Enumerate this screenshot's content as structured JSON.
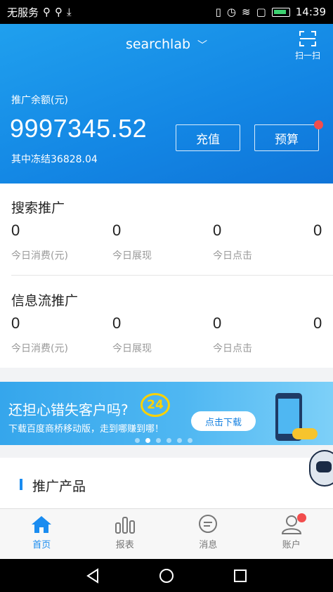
{
  "status_bar": {
    "carrier": "无服务",
    "time": "14:39"
  },
  "header": {
    "account": "searchlab",
    "scan_label": "扫一扫",
    "balance_label": "推广余额(元)",
    "balance_value": "9997345.52",
    "frozen_text": "其中冻结36828.04",
    "recharge_label": "充值",
    "budget_label": "预算"
  },
  "search_promo": {
    "title": "搜索推广",
    "stats": [
      {
        "value": "0",
        "label": "今日消费(元)"
      },
      {
        "value": "0",
        "label": "今日展现"
      },
      {
        "value": "0",
        "label": "今日点击"
      },
      {
        "value": "0",
        "label": ""
      }
    ]
  },
  "feed_promo": {
    "title": "信息流推广",
    "stats": [
      {
        "value": "0",
        "label": "今日消费(元)"
      },
      {
        "value": "0",
        "label": "今日展现"
      },
      {
        "value": "0",
        "label": "今日点击"
      },
      {
        "value": "0",
        "label": ""
      }
    ]
  },
  "banner": {
    "headline": "还担心错失客户吗?",
    "badge": "24",
    "subline": "下载百度商桥移动版，走到哪赚到哪！",
    "cta": "点击下载"
  },
  "products": {
    "title": "推广产品"
  },
  "tabs": [
    {
      "label": "首页",
      "icon": "home-icon",
      "active": true
    },
    {
      "label": "报表",
      "icon": "chart-icon",
      "active": false
    },
    {
      "label": "消息",
      "icon": "message-icon",
      "active": false
    },
    {
      "label": "账户",
      "icon": "user-icon",
      "active": false
    }
  ],
  "colors": {
    "brand_blue": "#1a8cf0",
    "alert_red": "#f24d4d"
  }
}
